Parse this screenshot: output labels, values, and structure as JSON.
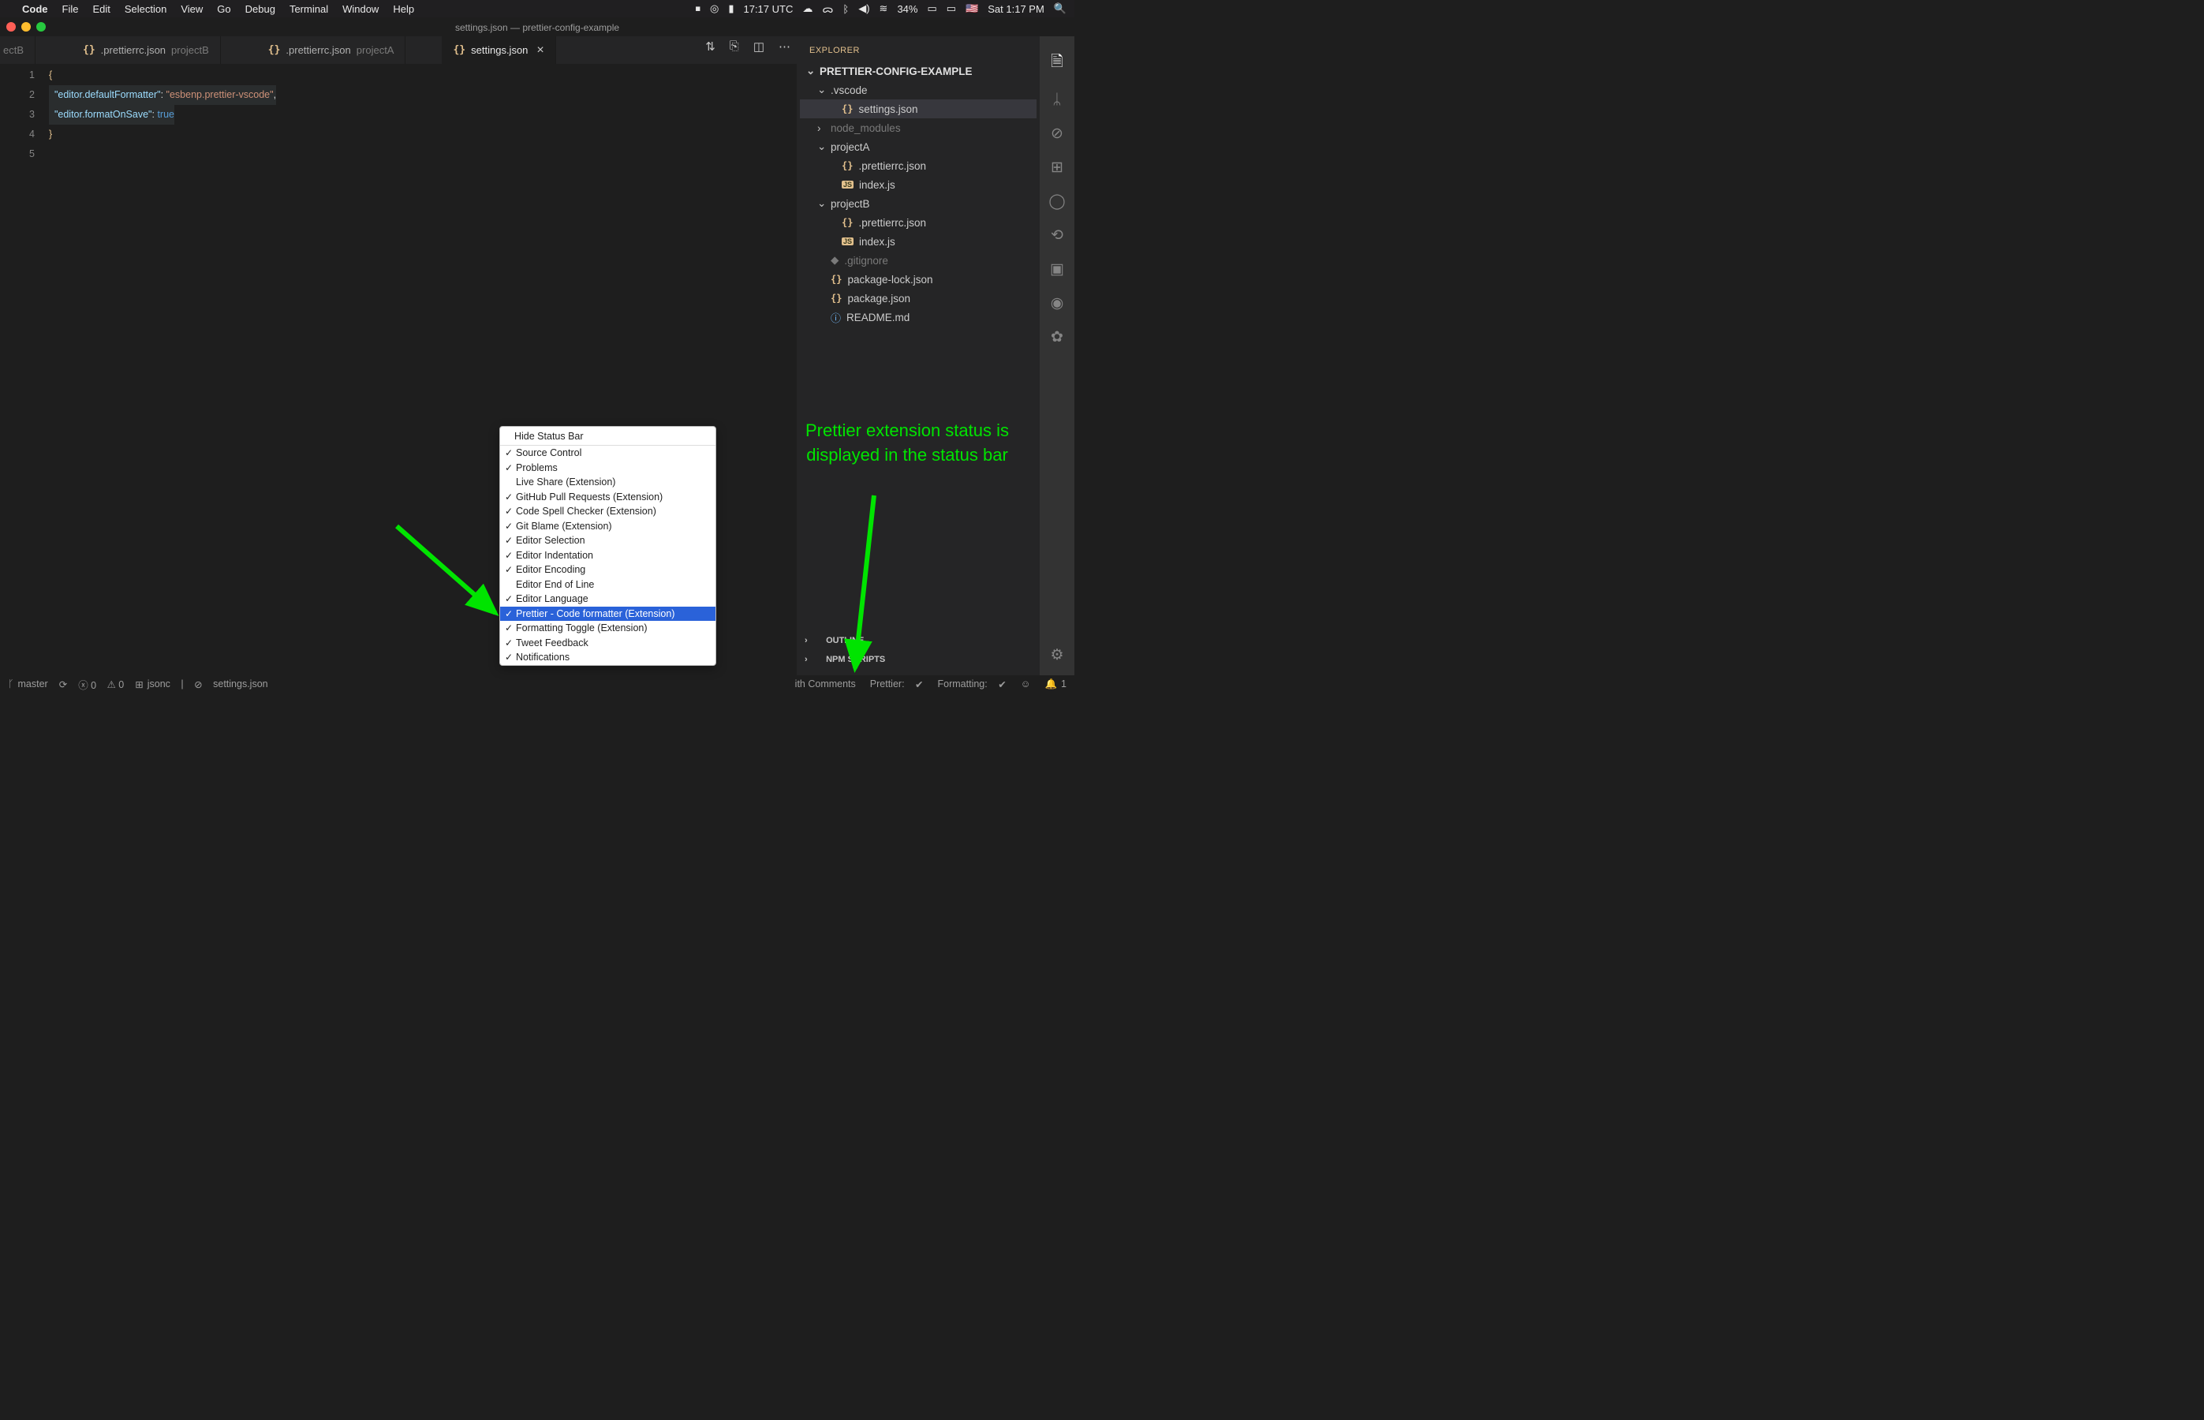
{
  "mac_menu": {
    "apple": "",
    "app": "Code",
    "items": [
      "File",
      "Edit",
      "Selection",
      "View",
      "Go",
      "Debug",
      "Terminal",
      "Window",
      "Help"
    ],
    "right": {
      "dropbox": "⏹",
      "o": "◎",
      "batt_ico": "▮",
      "time_utc": "17:17 UTC",
      "cloud": "☁︎",
      "eye": "ᯅ",
      "bt": "ᛒ",
      "vol": "◀︎)",
      "wifi": "≋",
      "pct": "34%",
      "batt": "▭",
      "display": "▭",
      "flag": "🇺🇸",
      "day": "Sat 1:17 PM",
      "search": "🔍"
    }
  },
  "window_title": "settings.json — prettier-config-example",
  "tabs": [
    {
      "file": "ectB",
      "proj": "",
      "icon": "",
      "partial": true
    },
    {
      "file": ".prettierrc.json",
      "proj": "projectB",
      "icon": "{}"
    },
    {
      "file": ".prettierrc.json",
      "proj": "projectA",
      "icon": "{}"
    },
    {
      "file": "settings.json",
      "proj": "",
      "icon": "{}",
      "active": true,
      "close": "×"
    }
  ],
  "editor_code": {
    "lines": [
      "1",
      "2",
      "3",
      "4",
      "5"
    ],
    "l1": "{",
    "l2_key": "\"editor.defaultFormatter\"",
    "l2_val": "\"esbenp.prettier-vscode\"",
    "l3_key": "\"editor.formatOnSave\"",
    "l3_val": "true",
    "l4": "}",
    "l5": ""
  },
  "explorer": {
    "title": "EXPLORER",
    "root": "PRETTIER-CONFIG-EXAMPLE",
    "nodes": [
      {
        "indent": 1,
        "arrow": "⌄",
        "label": ".vscode"
      },
      {
        "indent": 2,
        "arrow": "",
        "icon": "{}",
        "label": "settings.json",
        "active": true
      },
      {
        "indent": 1,
        "arrow": "›",
        "label": "node_modules",
        "ign": true
      },
      {
        "indent": 1,
        "arrow": "⌄",
        "label": "projectA"
      },
      {
        "indent": 2,
        "arrow": "",
        "icon": "{}",
        "label": ".prettierrc.json"
      },
      {
        "indent": 2,
        "arrow": "",
        "icon": "JS",
        "label": "index.js"
      },
      {
        "indent": 1,
        "arrow": "⌄",
        "label": "projectB"
      },
      {
        "indent": 2,
        "arrow": "",
        "icon": "{}",
        "label": ".prettierrc.json"
      },
      {
        "indent": 2,
        "arrow": "",
        "icon": "JS",
        "label": "index.js"
      },
      {
        "indent": 1,
        "arrow": "",
        "icon": "◆",
        "label": ".gitignore",
        "ign": true
      },
      {
        "indent": 1,
        "arrow": "",
        "icon": "{}",
        "label": "package-lock.json"
      },
      {
        "indent": 1,
        "arrow": "",
        "icon": "{}",
        "label": "package.json"
      },
      {
        "indent": 1,
        "arrow": "",
        "icon": "ⓘ",
        "label": "README.md"
      }
    ],
    "sections": [
      {
        "arrow": "›",
        "label": "OUTLINE"
      },
      {
        "arrow": "›",
        "label": "NPM SCRIPTS"
      }
    ]
  },
  "statusbar": {
    "branch_icon": "ᚴ",
    "branch": "master",
    "sync": "⟳",
    "err": "ⓧ 0",
    "warn": "⚠ 0",
    "lang_icon": "⊞",
    "lang": "jsonc",
    "sep": "|",
    "file_icon": "⊘",
    "file": "settings.json",
    "right": {
      "comments": "ith Comments",
      "prettier": "Prettier:",
      "pcheck": "✔︎",
      "formatting": "Formatting:",
      "fcheck": "✔︎",
      "smile": "☺",
      "bell": "🔔",
      "bellnum": "1"
    }
  },
  "context_menu": {
    "header": "Hide Status Bar",
    "items": [
      {
        "check": true,
        "label": "Source Control"
      },
      {
        "check": true,
        "label": "Problems"
      },
      {
        "check": false,
        "label": "Live Share (Extension)"
      },
      {
        "check": true,
        "label": "GitHub Pull Requests (Extension)"
      },
      {
        "check": true,
        "label": "Code Spell Checker (Extension)"
      },
      {
        "check": true,
        "label": "Git Blame (Extension)"
      },
      {
        "check": true,
        "label": "Editor Selection"
      },
      {
        "check": true,
        "label": "Editor Indentation"
      },
      {
        "check": true,
        "label": "Editor Encoding"
      },
      {
        "check": false,
        "label": "Editor End of Line"
      },
      {
        "check": true,
        "label": "Editor Language"
      },
      {
        "check": true,
        "label": "Prettier - Code formatter (Extension)",
        "selected": true
      },
      {
        "check": true,
        "label": "Formatting Toggle (Extension)"
      },
      {
        "check": true,
        "label": "Tweet Feedback"
      },
      {
        "check": true,
        "label": "Notifications"
      }
    ]
  },
  "annotation_sidebar": "Prettier extension status is displayed in the status bar"
}
